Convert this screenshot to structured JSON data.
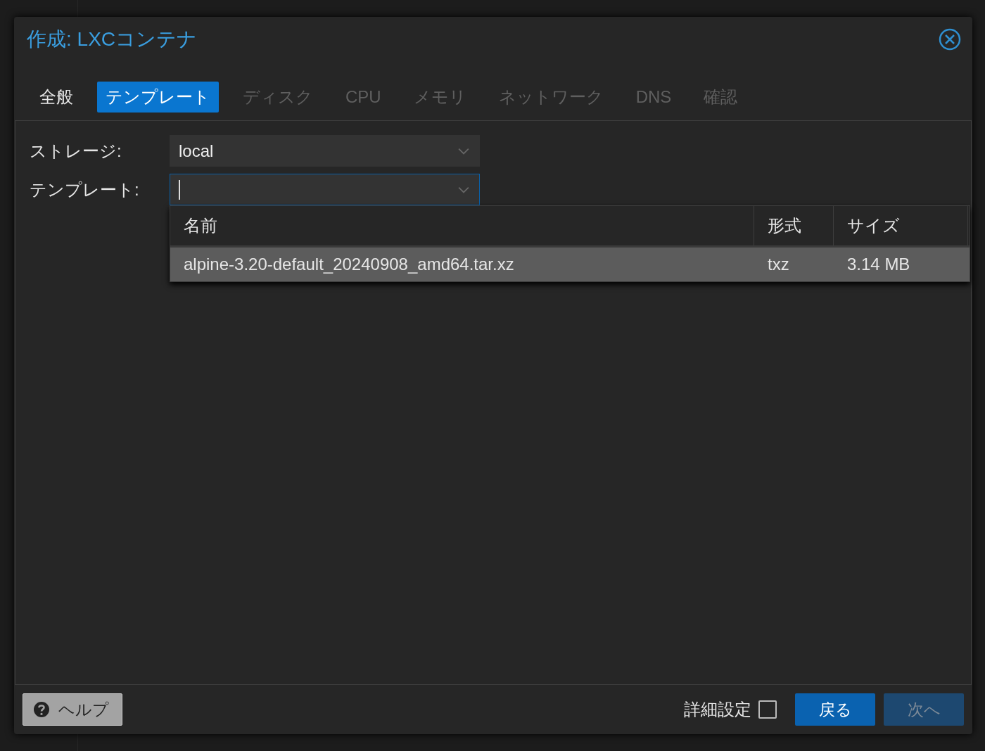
{
  "window": {
    "title": "作成: LXCコンテナ"
  },
  "tabs": [
    {
      "label": "全般",
      "selected": false,
      "disabled": false
    },
    {
      "label": "テンプレート",
      "selected": true,
      "disabled": false
    },
    {
      "label": "ディスク",
      "selected": false,
      "disabled": true
    },
    {
      "label": "CPU",
      "selected": false,
      "disabled": true
    },
    {
      "label": "メモリ",
      "selected": false,
      "disabled": true
    },
    {
      "label": "ネットワーク",
      "selected": false,
      "disabled": true
    },
    {
      "label": "DNS",
      "selected": false,
      "disabled": true
    },
    {
      "label": "確認",
      "selected": false,
      "disabled": true
    }
  ],
  "form": [
    {
      "label": "ストレージ:",
      "value": "local",
      "focused": false
    },
    {
      "label": "テンプレート:",
      "focused": true
    }
  ],
  "dropdown": {
    "columns": [
      "名前",
      "形式",
      "サイズ"
    ],
    "rows": [
      {
        "cells": [
          "alpine-3.20-default_20240908_amd64.tar.xz",
          "txz",
          "3.14 MB"
        ],
        "selected": true
      }
    ]
  },
  "footer": {
    "help": "ヘルプ",
    "advanced": {
      "label": "詳細設定",
      "checked": false
    },
    "buttons": [
      {
        "label": "戻る",
        "disabled": false
      },
      {
        "label": "次へ",
        "disabled": true
      }
    ]
  }
}
